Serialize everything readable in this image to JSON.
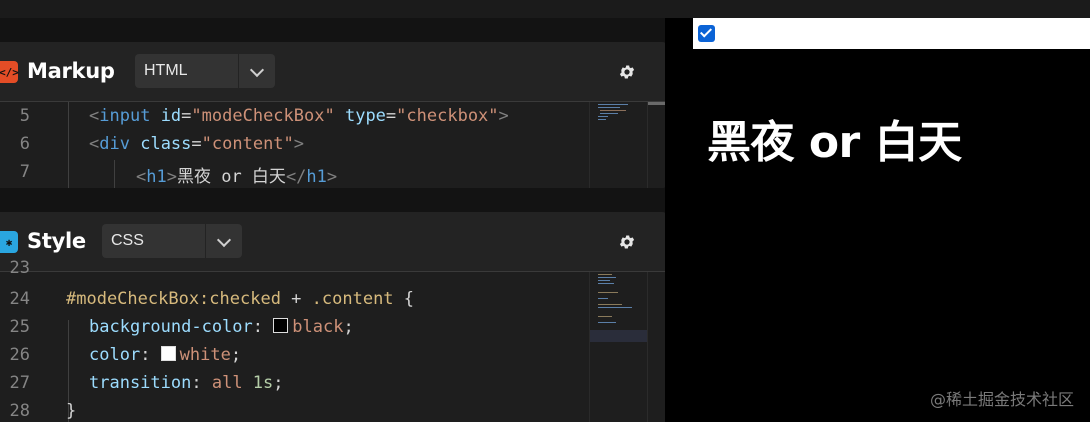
{
  "markup": {
    "title": "Markup",
    "icon": "code-brackets-icon",
    "icon_glyph": "</>",
    "language": "HTML",
    "settings_icon": "gear-icon",
    "lines": [
      {
        "num": "5",
        "html": [
          [
            "t-bracket",
            "<"
          ],
          [
            "t-tag",
            "input"
          ],
          [
            "t-text",
            " "
          ],
          [
            "t-attr",
            "id"
          ],
          [
            "t-eq",
            "="
          ],
          [
            "t-str",
            "\"modeCheckBox\""
          ],
          [
            "t-text",
            " "
          ],
          [
            "t-attr",
            "type"
          ],
          [
            "t-eq",
            "="
          ],
          [
            "t-str",
            "\"checkbox\""
          ],
          [
            "t-bracket",
            ">"
          ]
        ]
      },
      {
        "num": "6",
        "html": [
          [
            "t-bracket",
            "<"
          ],
          [
            "t-tag",
            "div"
          ],
          [
            "t-text",
            " "
          ],
          [
            "t-attr",
            "class"
          ],
          [
            "t-eq",
            "="
          ],
          [
            "t-str",
            "\"content\""
          ],
          [
            "t-bracket",
            ">"
          ]
        ]
      },
      {
        "num": "7",
        "html": [
          [
            "t-bracket",
            "<"
          ],
          [
            "t-tag",
            "h1"
          ],
          [
            "t-bracket",
            ">"
          ],
          [
            "t-text",
            "黑夜 or 白天"
          ],
          [
            "t-bracket",
            "</"
          ],
          [
            "t-tag",
            "h1"
          ],
          [
            "t-bracket",
            ">"
          ]
        ]
      }
    ]
  },
  "style": {
    "title": "Style",
    "icon": "asterisk-icon",
    "icon_glyph": "✱",
    "language": "CSS",
    "settings_icon": "gear-icon",
    "lines": [
      {
        "num": "23",
        "html": []
      },
      {
        "num": "24",
        "html": [
          [
            "t-sel",
            "#modeCheckBox:checked"
          ],
          [
            "t-text",
            " + "
          ],
          [
            "t-cls",
            ".content"
          ],
          [
            "t-text",
            " {"
          ]
        ]
      },
      {
        "num": "25",
        "html": [
          [
            "t-prop",
            "background-color"
          ],
          [
            "t-text",
            ": "
          ],
          [
            "swatch",
            "#000000"
          ],
          [
            "t-val",
            "black"
          ],
          [
            "t-text",
            ";"
          ]
        ]
      },
      {
        "num": "26",
        "html": [
          [
            "t-prop",
            "color"
          ],
          [
            "t-text",
            ": "
          ],
          [
            "swatch",
            "#ffffff"
          ],
          [
            "t-val",
            "white"
          ],
          [
            "t-text",
            ";"
          ]
        ]
      },
      {
        "num": "27",
        "html": [
          [
            "t-prop",
            "transition"
          ],
          [
            "t-text",
            ": "
          ],
          [
            "t-val",
            "all "
          ],
          [
            "t-num",
            "1s"
          ],
          [
            "t-text",
            ";"
          ]
        ]
      },
      {
        "num": "28",
        "html": [
          [
            "t-text",
            "}"
          ]
        ]
      }
    ]
  },
  "preview": {
    "checkbox_checked": true,
    "heading": "黑夜 or 白天",
    "watermark": "@稀土掘金技术社区"
  },
  "colors": {
    "markup_icon_bg": "#e44d26",
    "style_icon_bg": "#2aa6e0",
    "checkbox_blue": "#0b63d6"
  }
}
